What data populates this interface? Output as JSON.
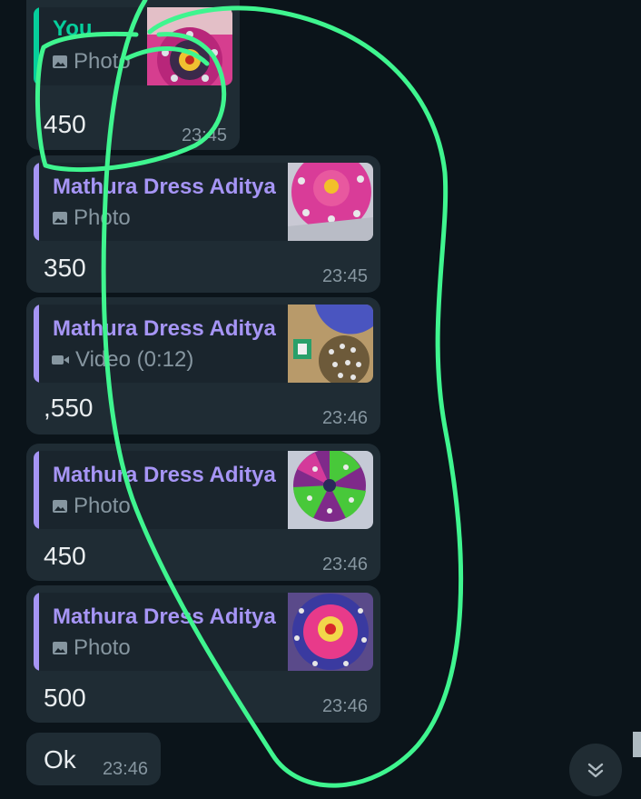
{
  "colors": {
    "background": "#0b141a",
    "bubble": "#1f2c34",
    "quote_bg": "#1a252d",
    "own_sender": "#06cf9c",
    "contact_sender": "#a695f5",
    "annotation": "#3ff58f"
  },
  "messages": [
    {
      "quote": {
        "sender": "You",
        "media_icon": "image-icon",
        "media_label": "Photo"
      },
      "text": "450",
      "time": "23:45"
    },
    {
      "quote": {
        "sender": "Mathura Dress Aditya",
        "media_icon": "image-icon",
        "media_label": "Photo"
      },
      "text": "350",
      "time": "23:45"
    },
    {
      "quote": {
        "sender": "Mathura Dress Aditya",
        "media_icon": "video-icon",
        "media_label": "Video (0:12)"
      },
      "text": ",550",
      "time": "23:46"
    },
    {
      "quote": {
        "sender": "Mathura Dress Aditya",
        "media_icon": "image-icon",
        "media_label": "Photo"
      },
      "text": "450",
      "time": "23:46"
    },
    {
      "quote": {
        "sender": "Mathura Dress Aditya",
        "media_icon": "image-icon",
        "media_label": "Photo"
      },
      "text": "500",
      "time": "23:46"
    },
    {
      "text": "Ok",
      "time": "23:46"
    }
  ],
  "scroll_button": {
    "icon": "double-chevron-down-icon"
  }
}
